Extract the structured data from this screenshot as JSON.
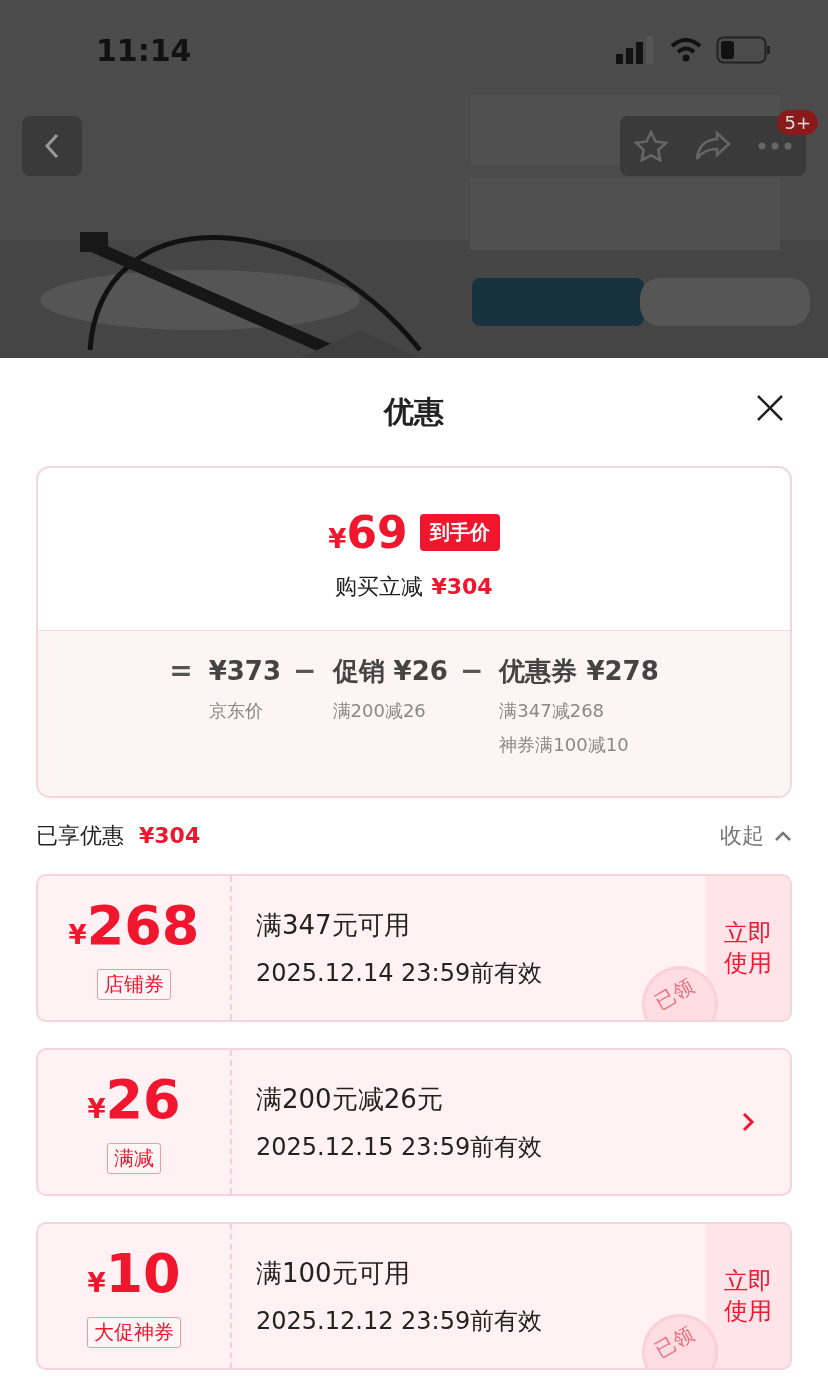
{
  "status_bar": {
    "time": "11:14"
  },
  "nav": {
    "badge": "5+"
  },
  "sheet": {
    "title": "优惠"
  },
  "summary": {
    "price_symbol": "¥",
    "price": "69",
    "price_tag": "到手价",
    "saving_label": "购买立减",
    "saving": "¥304",
    "breakdown": [
      {
        "operator": "=",
        "amount": "¥373",
        "notes": [
          "京东价"
        ]
      },
      {
        "operator": "−",
        "label": "促销",
        "amount": "¥26",
        "notes": [
          "满200减26"
        ]
      },
      {
        "operator": "−",
        "label": "优惠券",
        "amount": "¥278",
        "notes": [
          "满347减268",
          "神券满100减10"
        ]
      }
    ]
  },
  "enjoyed": {
    "label": "已享优惠",
    "amount": "¥304",
    "toggle": "收起",
    "expanded": true
  },
  "coupons": [
    {
      "symbol": "¥",
      "amount": "268",
      "tag": "店铺券",
      "condition": "满347元可用",
      "validity": "2025.12.14 23:59前有效",
      "action": {
        "kind": "use",
        "label": "立即使用"
      },
      "stamp": "已领"
    },
    {
      "symbol": "¥",
      "amount": "26",
      "tag": "满减",
      "condition": "满200元减26元",
      "validity": "2025.12.15 23:59前有效",
      "action": {
        "kind": "arrow"
      }
    },
    {
      "symbol": "¥",
      "amount": "10",
      "tag": "大促神券",
      "condition": "满100元可用",
      "validity": "2025.12.12 23:59前有效",
      "action": {
        "kind": "use",
        "label": "立即使用"
      },
      "stamp": "已领"
    }
  ]
}
